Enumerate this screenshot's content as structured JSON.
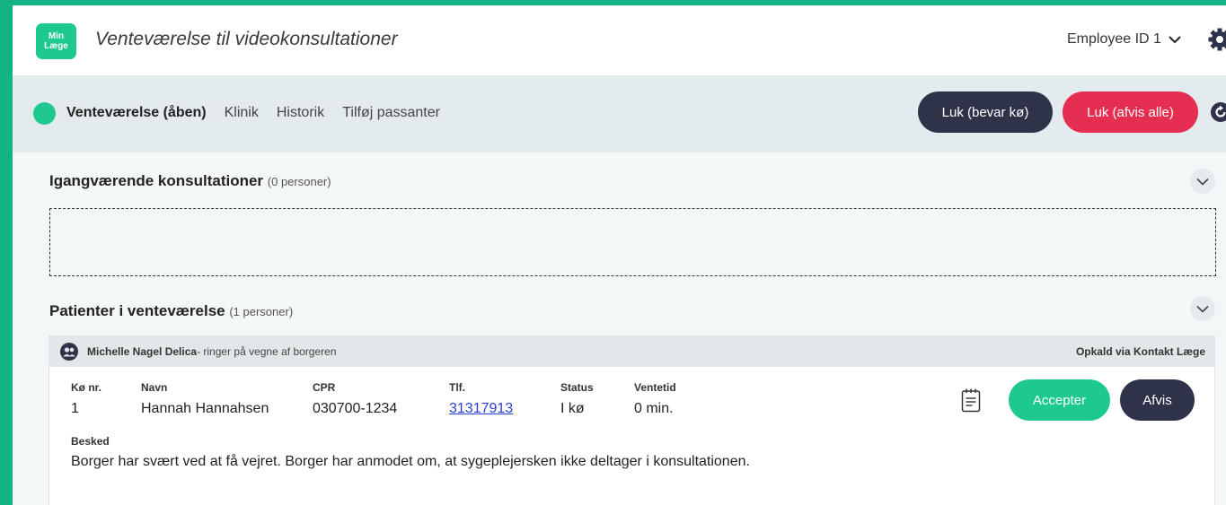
{
  "header": {
    "logo_line1": "Min",
    "logo_line2": "Læge",
    "title": "Venteværelse til videokonsultationer",
    "employee": "Employee ID 1"
  },
  "nav": {
    "active": "Venteværelse (åben)",
    "items": [
      "Klinik",
      "Historik",
      "Tilføj passanter"
    ],
    "keep_button": "Luk (bevar kø)",
    "reject_all_button": "Luk (afvis alle)"
  },
  "ongoing": {
    "title": "Igangværende konsultationer",
    "count": "(0 personer)"
  },
  "waiting": {
    "title": "Patienter i venteværelse",
    "count": "(1 personer)"
  },
  "card": {
    "caller": "Michelle Nagel Delica",
    "caller_suffix": "- ringer på vegne af borgeren",
    "via": "Opkald via Kontakt Læge",
    "columns": {
      "queue": {
        "label": "Kø nr.",
        "value": "1"
      },
      "name": {
        "label": "Navn",
        "value": "Hannah Hannahsen"
      },
      "cpr": {
        "label": "CPR",
        "value": "030700-1234"
      },
      "phone": {
        "label": "Tlf.",
        "value": "31317913"
      },
      "status": {
        "label": "Status",
        "value": "I kø"
      },
      "wait": {
        "label": "Ventetid",
        "value": "0 min."
      }
    },
    "message_label": "Besked",
    "message": "Borger har svært ved at få vejret. Borger har anmodet om, at sygeplejersken ikke deltager i konsultationen.",
    "accept_button": "Accepter",
    "reject_button": "Afvis"
  },
  "colors": {
    "brand_green": "#1ec990",
    "border_green": "#14b384",
    "dark": "#2f3349",
    "danger": "#e62e50"
  }
}
